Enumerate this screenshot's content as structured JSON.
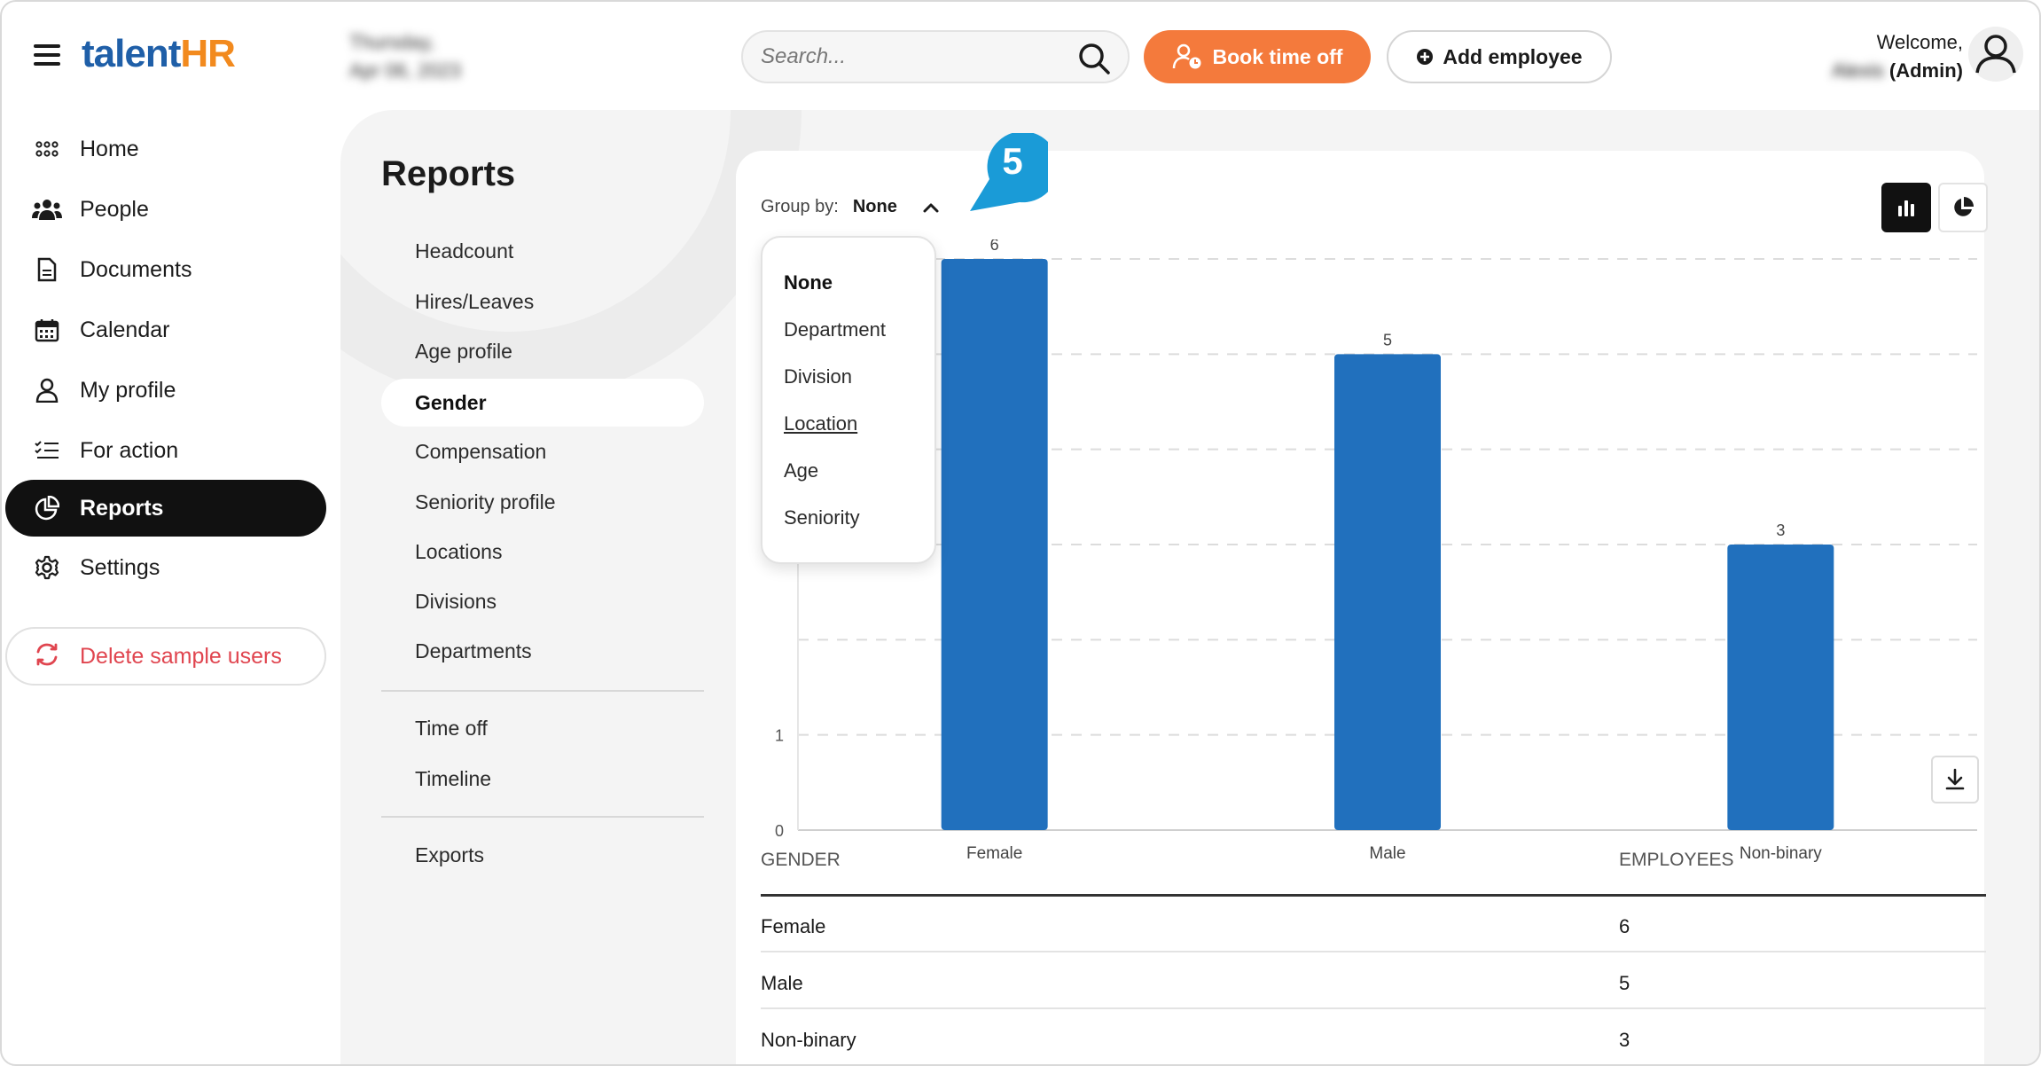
{
  "app": {
    "logo_part1": "talent",
    "logo_part2": "HR"
  },
  "header": {
    "date_line1": "Thursday,",
    "date_line2": "Apr 06, 2023",
    "search_placeholder": "Search...",
    "book_label": "Book time off",
    "add_label": "Add employee",
    "welcome": "Welcome,",
    "user_name": "Alexis",
    "user_role": "(Admin)"
  },
  "sidebar": {
    "items": [
      {
        "label": "Home",
        "icon": "grid-icon"
      },
      {
        "label": "People",
        "icon": "people-icon"
      },
      {
        "label": "Documents",
        "icon": "document-icon"
      },
      {
        "label": "Calendar",
        "icon": "calendar-icon"
      },
      {
        "label": "My profile",
        "icon": "user-icon"
      },
      {
        "label": "For action",
        "icon": "checklist-icon"
      },
      {
        "label": "Reports",
        "icon": "pie-chart-icon",
        "active": true
      },
      {
        "label": "Settings",
        "icon": "gear-icon"
      }
    ],
    "delete_label": "Delete sample users"
  },
  "reports": {
    "title": "Reports",
    "menu": [
      "Headcount",
      "Hires/Leaves",
      "Age profile",
      "Gender",
      "Compensation",
      "Seniority profile",
      "Locations",
      "Divisions",
      "Departments"
    ],
    "menu2": [
      "Time off",
      "Timeline"
    ],
    "menu3": [
      "Exports"
    ],
    "active": "Gender"
  },
  "groupby": {
    "label": "Group by:",
    "value": "None",
    "options": [
      "None",
      "Department",
      "Division",
      "Location",
      "Age",
      "Seniority"
    ],
    "hovered": "Location"
  },
  "callout": {
    "number": "5",
    "color": "#1a9bd7"
  },
  "chart_data": {
    "type": "bar",
    "categories": [
      "Female",
      "Male",
      "Non-binary"
    ],
    "values": [
      6,
      5,
      3
    ],
    "ylim": [
      0,
      6
    ],
    "yticks_visible": [
      0,
      1
    ],
    "bar_color": "#2170bd",
    "grid": "dashed-horizontal"
  },
  "table": {
    "headers": [
      "GENDER",
      "EMPLOYEES"
    ],
    "rows": [
      {
        "gender": "Female",
        "employees": "6"
      },
      {
        "gender": "Male",
        "employees": "5"
      },
      {
        "gender": "Non-binary",
        "employees": "3"
      }
    ]
  },
  "colors": {
    "accent_orange": "#f47a3c",
    "logo_blue": "#1f5fa8",
    "logo_orange": "#f28a1e",
    "danger": "#e0454f"
  }
}
